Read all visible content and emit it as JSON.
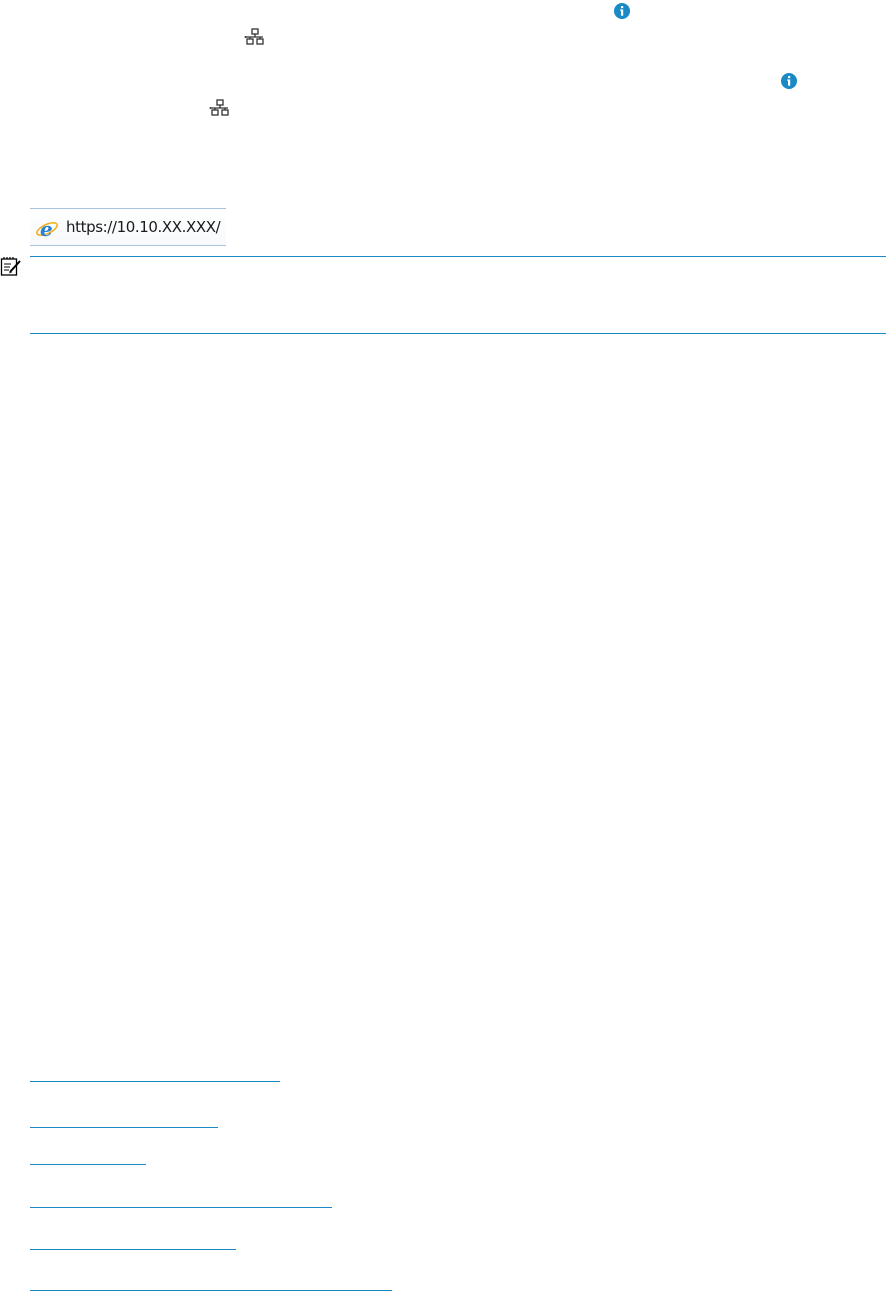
{
  "address_bar": {
    "url": "https://10.10.XX.XXX/"
  },
  "icons": {
    "info": "info-icon",
    "network": "network-icon",
    "browser": "internet-explorer-icon",
    "note": "note-icon"
  },
  "colors": {
    "info_blue": "#1a8ac6",
    "rule_blue": "#1a8ac6",
    "icon_gray": "#333333"
  },
  "links": [
    {
      "id": "link-1"
    },
    {
      "id": "link-2"
    },
    {
      "id": "link-3"
    },
    {
      "id": "link-4"
    },
    {
      "id": "link-5"
    },
    {
      "id": "link-6"
    }
  ]
}
